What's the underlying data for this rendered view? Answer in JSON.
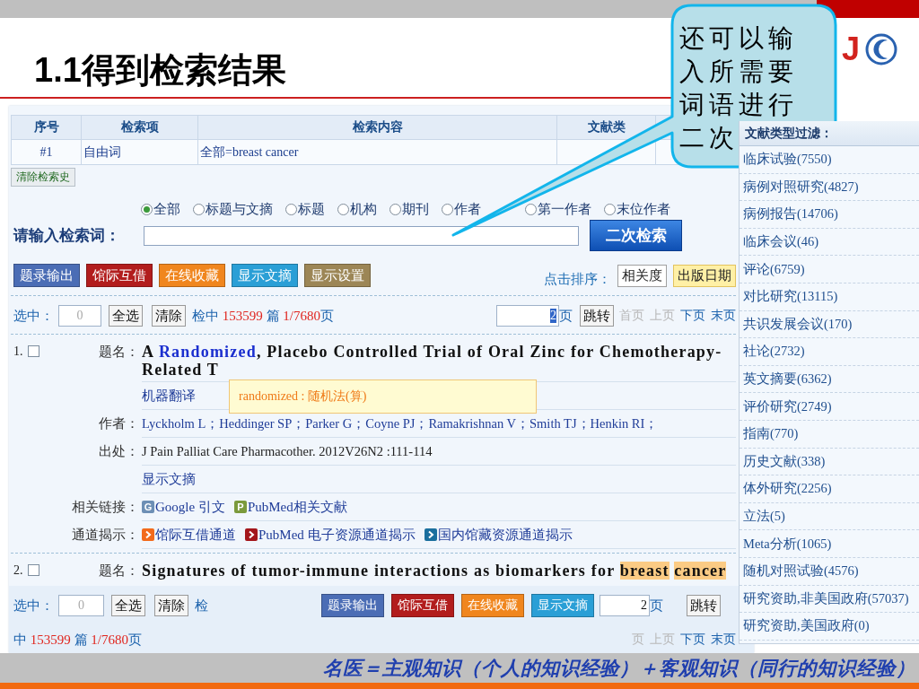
{
  "slide": {
    "title": "1.1得到检索结果",
    "logo_text": "J",
    "caption": "名医＝主观知识（个人的知识经验）＋客观知识（同行的知识经验）"
  },
  "callout": {
    "lines": [
      "还可以输",
      "入所需要",
      "词语进行",
      "二次"
    ]
  },
  "history_table": {
    "columns": [
      "序号",
      "检索项",
      "检索内容",
      "文献类"
    ],
    "rows": [
      {
        "cells": [
          "#1",
          "自由词",
          "全部=breast cancer"
        ]
      }
    ]
  },
  "clear_history": {
    "label": "清除检索史"
  },
  "search_fields": [
    {
      "label": "全部",
      "selected": true
    },
    {
      "label": "标题与文摘",
      "selected": false
    },
    {
      "label": "标题",
      "selected": false
    },
    {
      "label": "机构",
      "selected": false
    },
    {
      "label": "期刊",
      "selected": false
    },
    {
      "label": "作者",
      "selected": false
    },
    {
      "label": "第一作者",
      "selected": false
    },
    {
      "label": "末位作者",
      "selected": false
    }
  ],
  "search_box": {
    "label": "请输入检索词：",
    "button": "二次检索"
  },
  "toolbar": {
    "buttons": [
      {
        "label": "题录输出",
        "color": "#4b6db5"
      },
      {
        "label": "馆际互借",
        "color": "#b21d1d"
      },
      {
        "label": "在线收藏",
        "color": "#f0861e"
      },
      {
        "label": "显示文摘",
        "color": "#2a9fd6"
      },
      {
        "label": "显示设置",
        "color": "#9c8656"
      }
    ],
    "sort_label": "点击排序：",
    "sort_options": [
      {
        "label": "相关度",
        "selected": false
      },
      {
        "label": "出版日期",
        "selected": true
      }
    ]
  },
  "pager_top": {
    "select_label": "选中：",
    "select_count": "0",
    "select_all": "全选",
    "clear": "清除",
    "summary": [
      {
        "text": "检中 ",
        "kind": "label"
      },
      {
        "text": "153599",
        "kind": "number"
      },
      {
        "text": " 篇 ",
        "kind": "label"
      },
      {
        "text": "1/7680",
        "kind": "number"
      },
      {
        "text": "页",
        "kind": "label"
      }
    ],
    "page": {
      "value": "2",
      "highlighted": true
    },
    "page_unit": "页",
    "jump": "跳转",
    "links": [
      {
        "label": "首页",
        "disabled": true
      },
      {
        "label": "上页",
        "disabled": true
      },
      {
        "label": "下页",
        "disabled": false
      },
      {
        "label": "末页",
        "disabled": false
      }
    ]
  },
  "results": [
    {
      "number": "1.",
      "checked": false,
      "tooltip": "randomized : 随机法(算)",
      "fields": [
        {
          "kind": "title",
          "label": "题名：",
          "segments": [
            {
              "text": "A ",
              "kind": "plain"
            },
            {
              "text": "Randomized",
              "kind": "hover"
            },
            {
              "text": ", Placebo Controlled Trial of Oral Zinc for Chemotherapy-Related T",
              "kind": "plain"
            }
          ]
        },
        {
          "kind": "link",
          "text": "机器翻译"
        },
        {
          "kind": "authors",
          "label": "作者：",
          "items": [
            "Lyckholm L；",
            "Heddinger SP；",
            "Parker G；",
            "Coyne PJ；",
            "Ramakrishnan V；",
            "Smith TJ；",
            "Henkin RI；"
          ]
        },
        {
          "kind": "text",
          "label": "出处：",
          "text": "J Pain Palliat Care Pharmacother. 2012V26N2 :111-114"
        },
        {
          "kind": "link",
          "text": "显示文摘"
        },
        {
          "kind": "badges",
          "label": "相关链接：",
          "items": [
            {
              "badge": "G",
              "text": "Google 引文",
              "color": "#6d8fb5"
            },
            {
              "badge": "P",
              "text": "PubMed相关文献",
              "color": "#7b9a3c"
            }
          ]
        },
        {
          "kind": "channels",
          "label": "通道揭示：",
          "items": [
            {
              "text": "馆际互借通道",
              "color": "#f26a1b"
            },
            {
              "text": "PubMed 电子资源通道揭示",
              "color": "#a3161b"
            },
            {
              "text": "国内馆藏资源通道揭示",
              "color": "#1b6f9e"
            }
          ]
        }
      ]
    },
    {
      "number": "2.",
      "checked": false,
      "fields": [
        {
          "kind": "title",
          "label": "题名：",
          "segments": [
            {
              "text": "Signatures of tumor-immune interactions as biomarkers for ",
              "kind": "plain"
            },
            {
              "text": "breast",
              "kind": "hit"
            },
            {
              "text": "cancer",
              "kind": "hit"
            }
          ]
        }
      ]
    }
  ],
  "pager_bottom": {
    "select_label": "选中：",
    "select_count": "0",
    "select_all": "全选",
    "clear": "清除",
    "cut_text": "检",
    "buttons": [
      {
        "label": "题录输出",
        "color": "#4b6db5"
      },
      {
        "label": "馆际互借",
        "color": "#b21d1d"
      },
      {
        "label": "在线收藏",
        "color": "#f0861e"
      },
      {
        "label": "显示文摘",
        "color": "#2a9fd6"
      }
    ],
    "page": {
      "value": "2",
      "highlighted": false
    },
    "page_unit": "页",
    "jump": "跳转",
    "summary": [
      {
        "text": "中 ",
        "kind": "label"
      },
      {
        "text": "153599",
        "kind": "number"
      },
      {
        "text": " 篇 ",
        "kind": "label"
      },
      {
        "text": "1/7680",
        "kind": "number"
      },
      {
        "text": "页",
        "kind": "label"
      }
    ],
    "links": [
      {
        "label": "页",
        "disabled": true
      },
      {
        "label": "上页",
        "disabled": true
      },
      {
        "label": "下页",
        "disabled": false
      },
      {
        "label": "末页",
        "disabled": false
      }
    ]
  },
  "filter_panel": {
    "title": "文献类型过滤：",
    "items": [
      "临床试验(7550)",
      "病例对照研究(4827)",
      "病例报告(14706)",
      "临床会议(46)",
      "评论(6759)",
      "对比研究(13115)",
      "共识发展会议(170)",
      "社论(2732)",
      "英文摘要(6362)",
      "评价研究(2749)",
      "指南(770)",
      "历史文献(338)",
      "体外研究(2256)",
      "立法(5)",
      "Meta分析(1065)",
      "随机对照试验(4576)",
      "研究资助,非美国政府(57037)",
      "研究资助,美国政府(0)"
    ]
  }
}
